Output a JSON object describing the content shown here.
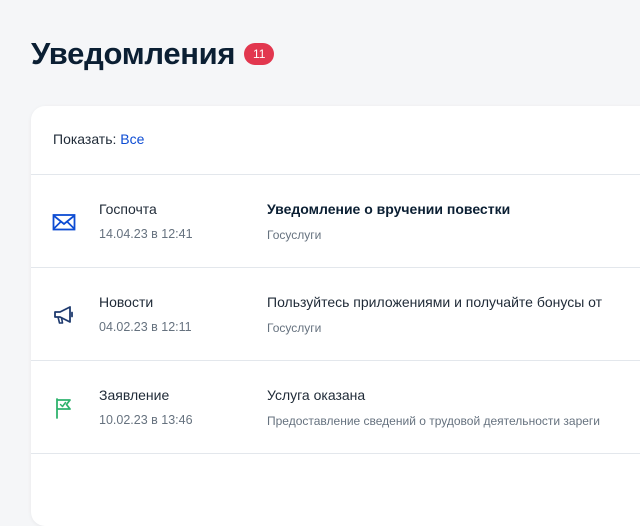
{
  "header": {
    "title": "Уведомления",
    "badge_count": "11"
  },
  "filter": {
    "label": "Показать:",
    "value": "Все"
  },
  "colors": {
    "accent": "#0d4cd3",
    "badge": "#e2374f",
    "icon_blue": "#0d4cd3",
    "icon_green": "#2fb36e"
  },
  "notifications": [
    {
      "icon": "envelope-icon",
      "category": "Госпочта",
      "date": "14.04.23 в 12:41",
      "title": "Уведомление о вручении повестки",
      "source": "Госуслуги",
      "unread": true
    },
    {
      "icon": "megaphone-icon",
      "category": "Новости",
      "date": "04.02.23 в 12:11",
      "title": "Пользуйтесь приложениями и получайте бонусы от",
      "source": "Госуслуги",
      "unread": false
    },
    {
      "icon": "flag-icon",
      "category": "Заявление",
      "date": "10.02.23 в 13:46",
      "title": "Услуга оказана",
      "source": "Предоставление сведений о трудовой деятельности зареги",
      "unread": false
    }
  ]
}
